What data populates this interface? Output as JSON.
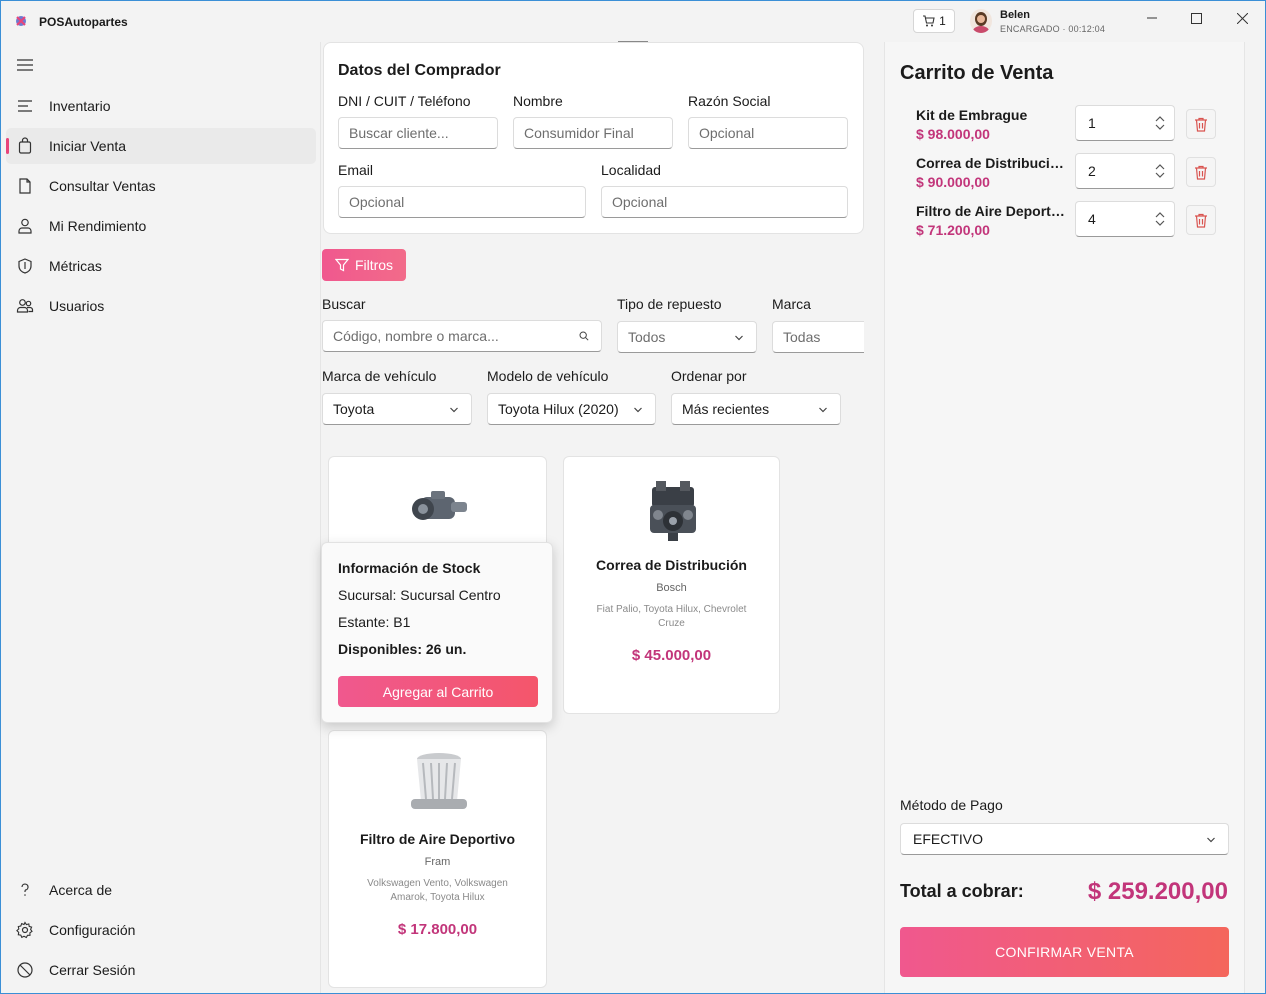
{
  "app": {
    "title": "POSAutopartes"
  },
  "titlebar": {
    "cart_count": "1",
    "user_name": "Belen",
    "user_role": "ENCARGADO",
    "session_time": "00:12:04"
  },
  "sidebar": {
    "items": [
      {
        "label": "Inventario",
        "icon": "list-icon"
      },
      {
        "label": "Iniciar Venta",
        "icon": "shopping-bag-icon",
        "active": true
      },
      {
        "label": "Consultar Ventas",
        "icon": "document-icon"
      },
      {
        "label": "Mi Rendimiento",
        "icon": "person-icon"
      },
      {
        "label": "Métricas",
        "icon": "shield-icon"
      },
      {
        "label": "Usuarios",
        "icon": "people-icon"
      }
    ],
    "bottom_items": [
      {
        "label": "Acerca de",
        "icon": "question-icon"
      },
      {
        "label": "Configuración",
        "icon": "gear-icon"
      },
      {
        "label": "Cerrar Sesión",
        "icon": "logout-icon"
      }
    ]
  },
  "buyer": {
    "title": "Datos del Comprador",
    "dni_label": "DNI / CUIT / Teléfono",
    "dni_placeholder": "Buscar cliente...",
    "name_label": "Nombre",
    "name_value": "Consumidor Final",
    "razon_label": "Razón Social",
    "razon_placeholder": "Opcional",
    "email_label": "Email",
    "email_placeholder": "Opcional",
    "localidad_label": "Localidad",
    "localidad_placeholder": "Opcional"
  },
  "filters": {
    "button_label": "Filtros",
    "search_label": "Buscar",
    "search_placeholder": "Código, nombre o marca...",
    "type_label": "Tipo de repuesto",
    "type_value": "Todos",
    "brand_label": "Marca",
    "brand_value": "Todas",
    "vehicle_brand_label": "Marca de vehículo",
    "vehicle_brand_value": "Toyota",
    "vehicle_model_label": "Modelo de vehículo",
    "vehicle_model_value": "Toyota Hilux (2020)",
    "order_label": "Ordenar por",
    "order_value": "Más recientes"
  },
  "products": [
    {
      "name": "Correa de Distribución",
      "brand": "Bosch",
      "compat": "Fiat Palio, Toyota Hilux, Chevrolet Cruze",
      "price": "$ 45.000,00"
    },
    {
      "name": "Filtro de Aire Deportivo",
      "brand": "Fram",
      "compat": "Volkswagen Vento, Volkswagen Amarok, Toyota Hilux",
      "price": "$ 17.800,00"
    }
  ],
  "stock_popup": {
    "title": "Información de Stock",
    "branch": "Sucursal: Sucursal Centro",
    "shelf": "Estante: B1",
    "available": "Disponibles: 26 un.",
    "button": "Agregar al Carrito"
  },
  "cart": {
    "title": "Carrito de Venta",
    "items": [
      {
        "name": "Kit de Embrague",
        "price": "$ 98.000,00",
        "qty": "1"
      },
      {
        "name": "Correa de Distribución",
        "price": "$ 90.000,00",
        "qty": "2"
      },
      {
        "name": "Filtro de Aire Deportivo",
        "price": "$ 71.200,00",
        "qty": "4"
      }
    ],
    "payment_label": "Método de Pago",
    "payment_value": "EFECTIVO",
    "total_label": "Total a cobrar:",
    "total_value": "$ 259.200,00",
    "confirm_label": "CONFIRMAR VENTA"
  },
  "colors": {
    "accent": "#e8457a",
    "price": "#c2357a",
    "button_gradient_start": "#f0588e",
    "button_gradient_end": "#f4665c"
  }
}
